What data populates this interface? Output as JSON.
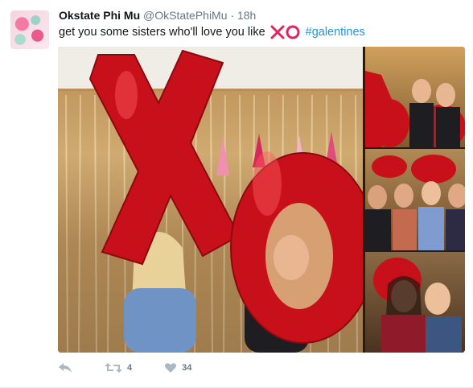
{
  "tweet": {
    "name": "Okstate Phi Mu",
    "handle": "@OkStatePhiMu",
    "separator": "·",
    "time": "18h",
    "text_before": "get you some sisters who'll love you like",
    "emoji_name": "xo-emoji",
    "hashtag": "#galentines",
    "colors": {
      "brand": "#1b95e0",
      "emoji_red": "#e0245e",
      "balloon_red": "#d0121b"
    }
  },
  "actions": {
    "reply_icon": "reply-icon",
    "retweet_icon": "retweet-icon",
    "retweet_count": "4",
    "like_icon": "heart-icon",
    "like_count": "34"
  },
  "media": {
    "photos": [
      {
        "name": "main-photo",
        "description": "xo-balloons"
      },
      {
        "name": "photo-thumb-1"
      },
      {
        "name": "photo-thumb-2"
      },
      {
        "name": "photo-thumb-3"
      }
    ]
  }
}
